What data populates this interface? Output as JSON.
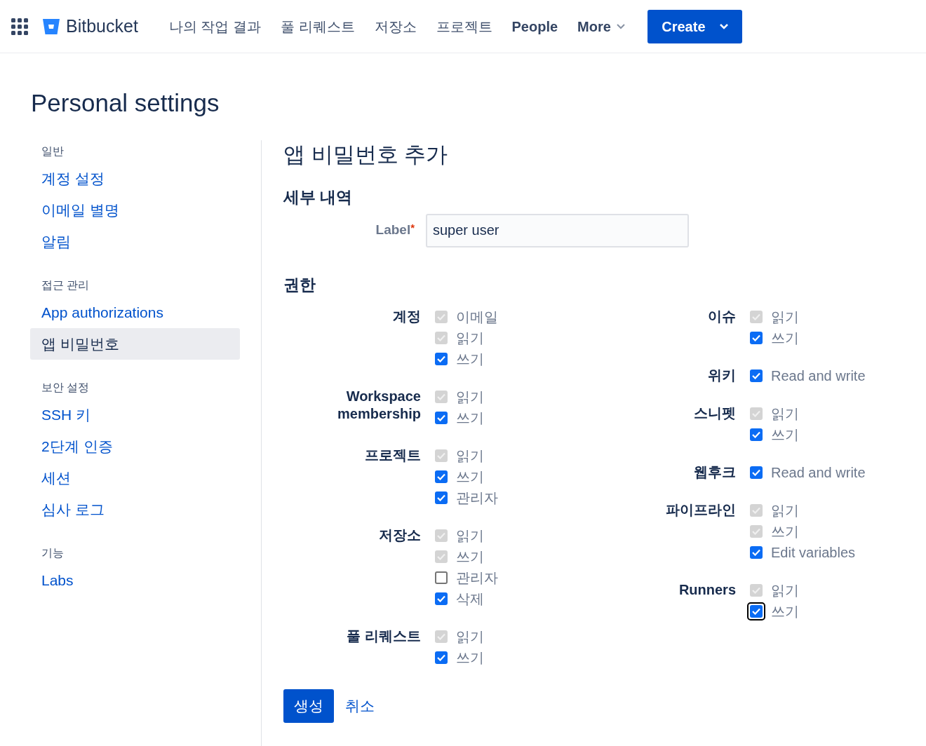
{
  "nav": {
    "product": "Bitbucket",
    "items": [
      {
        "label": "나의 작업 결과",
        "kind": "link"
      },
      {
        "label": "풀 리퀘스트",
        "kind": "link"
      },
      {
        "label": "저장소",
        "kind": "link"
      },
      {
        "label": "프로젝트",
        "kind": "link"
      },
      {
        "label": "People",
        "kind": "link"
      },
      {
        "label": "More",
        "kind": "dropdown"
      }
    ],
    "create": "Create"
  },
  "page_title": "Personal settings",
  "sidebar": [
    {
      "heading": "일반",
      "items": [
        {
          "label": "계정 설정",
          "selected": false
        },
        {
          "label": "이메일 별명",
          "selected": false
        },
        {
          "label": "알림",
          "selected": false
        }
      ]
    },
    {
      "heading": "접근 관리",
      "items": [
        {
          "label": "App authorizations",
          "selected": false
        },
        {
          "label": "앱 비밀번호",
          "selected": true
        }
      ]
    },
    {
      "heading": "보안 설정",
      "items": [
        {
          "label": "SSH 키",
          "selected": false
        },
        {
          "label": "2단계 인증",
          "selected": false
        },
        {
          "label": "세션",
          "selected": false
        },
        {
          "label": "심사 로그",
          "selected": false
        }
      ]
    },
    {
      "heading": "기능",
      "items": [
        {
          "label": "Labs",
          "selected": false
        }
      ]
    }
  ],
  "form": {
    "title": "앱 비밀번호 추가",
    "details_heading": "세부 내역",
    "label_field": {
      "label": "Label",
      "required_mark": "*",
      "value": "super user"
    },
    "permissions_heading": "권한",
    "columns": [
      [
        {
          "name": "계정",
          "options": [
            {
              "label": "이메일",
              "checked": true,
              "disabled": true,
              "focused": false
            },
            {
              "label": "읽기",
              "checked": true,
              "disabled": true,
              "focused": false
            },
            {
              "label": "쓰기",
              "checked": true,
              "disabled": false,
              "focused": false
            }
          ]
        },
        {
          "name": "Workspace membership",
          "options": [
            {
              "label": "읽기",
              "checked": true,
              "disabled": true,
              "focused": false
            },
            {
              "label": "쓰기",
              "checked": true,
              "disabled": false,
              "focused": false
            }
          ]
        },
        {
          "name": "프로젝트",
          "options": [
            {
              "label": "읽기",
              "checked": true,
              "disabled": true,
              "focused": false
            },
            {
              "label": "쓰기",
              "checked": true,
              "disabled": false,
              "focused": false
            },
            {
              "label": "관리자",
              "checked": true,
              "disabled": false,
              "focused": false
            }
          ]
        },
        {
          "name": "저장소",
          "options": [
            {
              "label": "읽기",
              "checked": true,
              "disabled": true,
              "focused": false
            },
            {
              "label": "쓰기",
              "checked": true,
              "disabled": true,
              "focused": false
            },
            {
              "label": "관리자",
              "checked": false,
              "disabled": false,
              "focused": false
            },
            {
              "label": "삭제",
              "checked": true,
              "disabled": false,
              "focused": false
            }
          ]
        },
        {
          "name": "풀 리퀘스트",
          "options": [
            {
              "label": "읽기",
              "checked": true,
              "disabled": true,
              "focused": false
            },
            {
              "label": "쓰기",
              "checked": true,
              "disabled": false,
              "focused": false
            }
          ]
        }
      ],
      [
        {
          "name": "이슈",
          "options": [
            {
              "label": "읽기",
              "checked": true,
              "disabled": true,
              "focused": false
            },
            {
              "label": "쓰기",
              "checked": true,
              "disabled": false,
              "focused": false
            }
          ]
        },
        {
          "name": "위키",
          "options": [
            {
              "label": "Read and write",
              "checked": true,
              "disabled": false,
              "focused": false
            }
          ]
        },
        {
          "name": "스니펫",
          "options": [
            {
              "label": "읽기",
              "checked": true,
              "disabled": true,
              "focused": false
            },
            {
              "label": "쓰기",
              "checked": true,
              "disabled": false,
              "focused": false
            }
          ]
        },
        {
          "name": "웹후크",
          "options": [
            {
              "label": "Read and write",
              "checked": true,
              "disabled": false,
              "focused": false
            }
          ]
        },
        {
          "name": "파이프라인",
          "options": [
            {
              "label": "읽기",
              "checked": true,
              "disabled": true,
              "focused": false
            },
            {
              "label": "쓰기",
              "checked": true,
              "disabled": true,
              "focused": false
            },
            {
              "label": "Edit variables",
              "checked": true,
              "disabled": false,
              "focused": false
            }
          ]
        },
        {
          "name": "Runners",
          "options": [
            {
              "label": "읽기",
              "checked": true,
              "disabled": true,
              "focused": false
            },
            {
              "label": "쓰기",
              "checked": true,
              "disabled": false,
              "focused": true
            }
          ]
        }
      ]
    ],
    "submit": "생성",
    "cancel": "취소"
  }
}
